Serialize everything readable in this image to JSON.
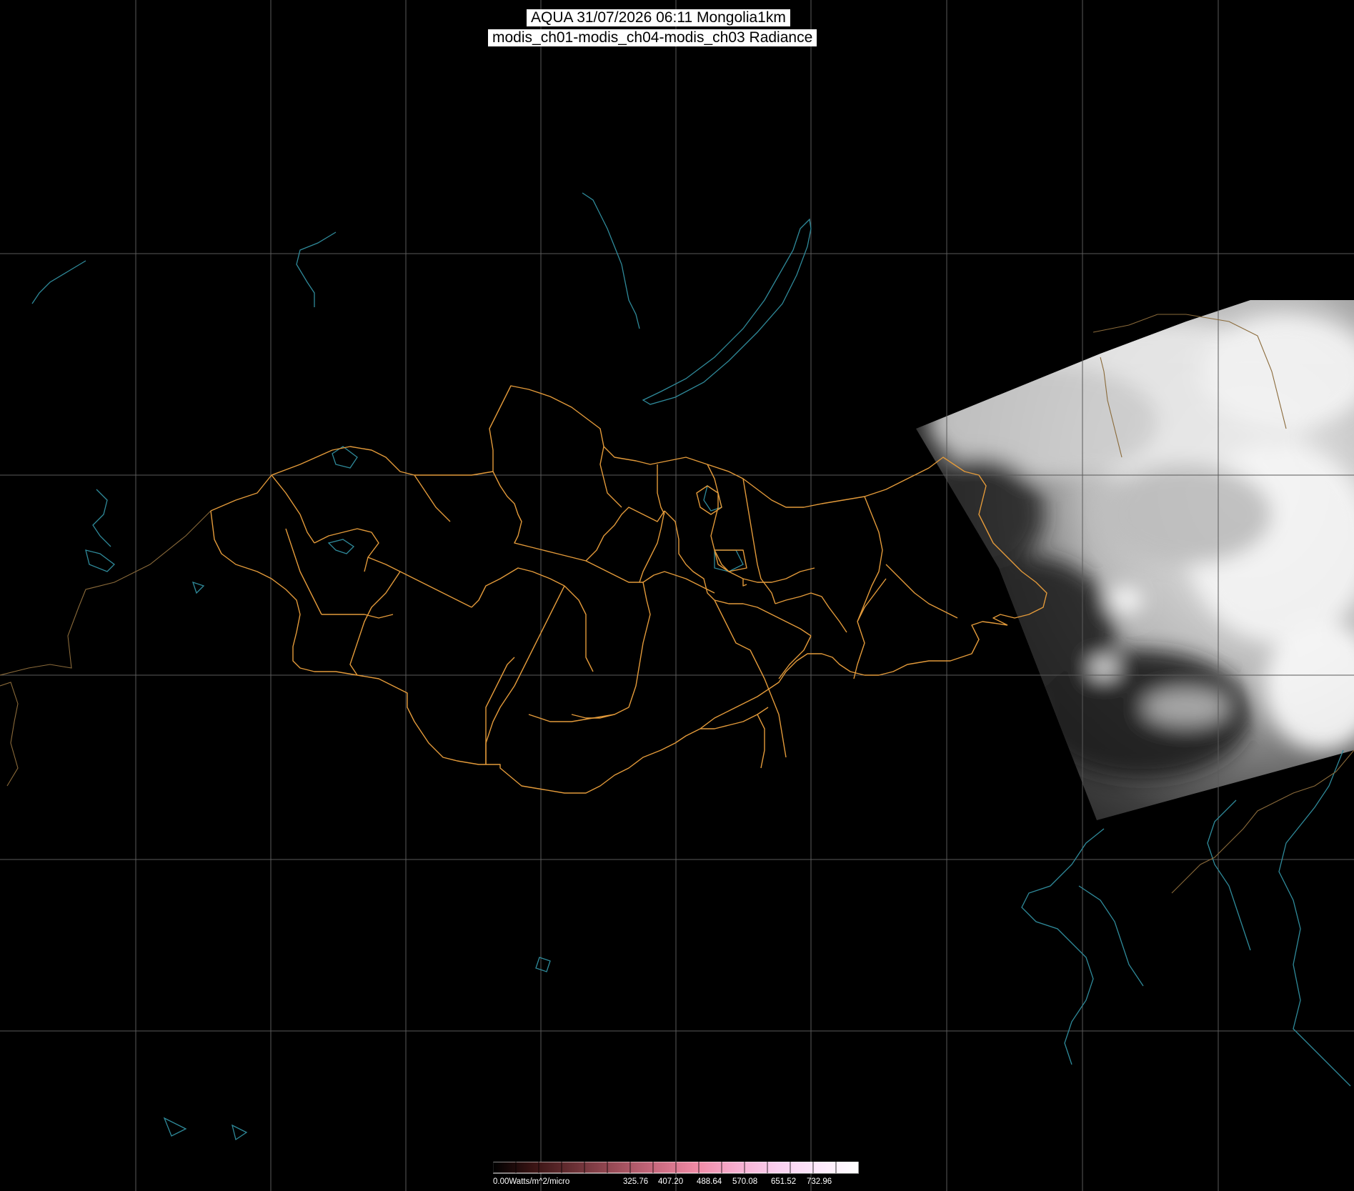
{
  "title": {
    "line1": "AQUA 31/07/2026 06:11 Mongolia1km",
    "line2": "modis_ch01-modis_ch04-modis_ch03 Radiance"
  },
  "colorbar": {
    "min_label": "0.00Watts/m^2/micro",
    "tick_labels": [
      "325.76",
      "407.20",
      "488.64",
      "570.08",
      "651.52",
      "732.96"
    ],
    "colors": [
      "#000000",
      "#3a1414",
      "#6a3035",
      "#9b4c58",
      "#c9697e",
      "#f08aa5",
      "#f7aed0",
      "#fad0f0",
      "#fde8fb",
      "#ffffff"
    ]
  },
  "map_colors": {
    "background": "#000000",
    "grid": "#5a5a5a",
    "coastline": "#2f8a9a",
    "aimag_border": "#e39a3a",
    "country_border": "#8a6a3a"
  }
}
